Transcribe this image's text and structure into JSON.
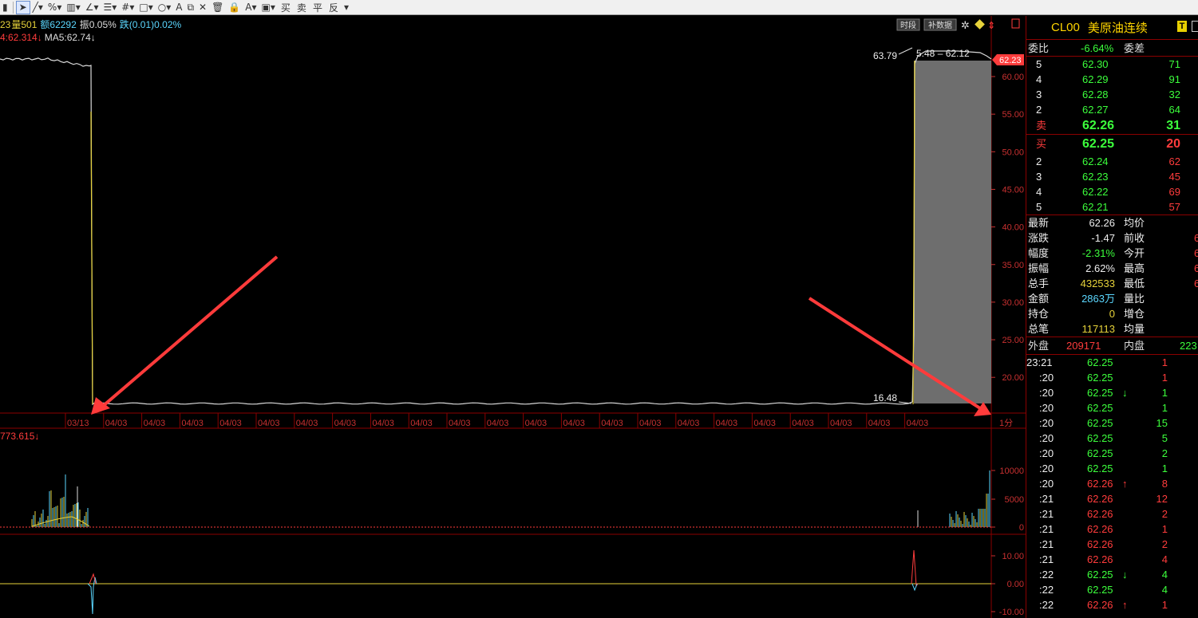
{
  "toolbar": {
    "trade_labels": [
      "买",
      "卖",
      "平",
      "反"
    ]
  },
  "chart": {
    "info_line": {
      "prefix": "23",
      "vol_label": "量501",
      "amount_label": "额62292",
      "amp_label": "振0.05%",
      "change_label": "跌(0.01)0.02%"
    },
    "ma_line": {
      "ma_value": "4:62.314↓",
      "ma5": "MA5:62.74↓"
    },
    "buttons": {
      "time_share": "时段",
      "fill_data": "补数据"
    },
    "price_labels": {
      "high": "63.79",
      "range": "5.48 – 62.12",
      "low": "16.48",
      "current": "62.23"
    },
    "price_axis": [
      "60.00",
      "55.00",
      "50.00",
      "45.00",
      "40.00",
      "35.00",
      "30.00",
      "25.00",
      "20.00"
    ],
    "date_axis": [
      "03/13",
      "04/03",
      "04/03",
      "04/03",
      "04/03",
      "04/03",
      "04/03",
      "04/03",
      "04/03",
      "04/03",
      "04/03",
      "04/03",
      "04/03",
      "04/03",
      "04/03",
      "04/03",
      "04/03",
      "04/03",
      "04/03",
      "04/03",
      "04/03",
      "04/03",
      "04/03"
    ],
    "period_label": "1分",
    "volume": {
      "label": "773.615↓",
      "axis": [
        "10000",
        "5000",
        "0"
      ]
    },
    "indicator": {
      "axis": [
        "10.00",
        "0.00",
        "-10.00"
      ]
    },
    "colors": {
      "grid": "#8b0000",
      "axis_text": "#c83030",
      "price_line": "#d8d8d8",
      "ma_line": "#e6d23a",
      "fill": "#6e6e6e",
      "arrow": "#ff3b3b"
    }
  },
  "quote": {
    "code": "CL00",
    "name": "美原油连续",
    "ratio_label": "委比",
    "ratio_value": "-6.64%",
    "diff_label": "委差",
    "sells": [
      {
        "level": "5",
        "price": "62.30",
        "vol": "71"
      },
      {
        "level": "4",
        "price": "62.29",
        "vol": "91"
      },
      {
        "level": "3",
        "price": "62.28",
        "vol": "32"
      },
      {
        "level": "2",
        "price": "62.27",
        "vol": "64"
      },
      {
        "level": "卖",
        "price": "62.26",
        "vol": "31"
      }
    ],
    "buys": [
      {
        "level": "买",
        "price": "62.25",
        "vol": "20"
      },
      {
        "level": "2",
        "price": "62.24",
        "vol": "62"
      },
      {
        "level": "3",
        "price": "62.23",
        "vol": "45"
      },
      {
        "level": "4",
        "price": "62.22",
        "vol": "69"
      },
      {
        "level": "5",
        "price": "62.21",
        "vol": "57"
      }
    ],
    "stats": [
      {
        "l1": "最新",
        "v1": "62.26",
        "c1": "white",
        "l2": "均价",
        "v2": ""
      },
      {
        "l1": "涨跌",
        "v1": "-1.47",
        "c1": "white",
        "l2": "前收",
        "v2": "6"
      },
      {
        "l1": "幅度",
        "v1": "-2.31%",
        "c1": "green",
        "l2": "今开",
        "v2": "6"
      },
      {
        "l1": "振幅",
        "v1": "2.62%",
        "c1": "white",
        "l2": "最高",
        "v2": "6"
      },
      {
        "l1": "总手",
        "v1": "432533",
        "c1": "yellow",
        "l2": "最低",
        "v2": "6"
      },
      {
        "l1": "金额",
        "v1": "2863万",
        "c1": "cyan",
        "l2": "量比",
        "v2": ""
      },
      {
        "l1": "持仓",
        "v1": "0",
        "c1": "yellow",
        "l2": "增仓",
        "v2": ""
      },
      {
        "l1": "总笔",
        "v1": "117113",
        "c1": "yellow",
        "l2": "均量",
        "v2": ""
      }
    ],
    "outer_label": "外盘",
    "outer_value": "209171",
    "inner_label": "内盘",
    "inner_value": "223",
    "ticks": [
      {
        "time": "23:21",
        "price": "62.25",
        "dir": "",
        "vol": "1",
        "vc": "red"
      },
      {
        "time": ":20",
        "price": "62.25",
        "dir": "",
        "vol": "1",
        "vc": "red"
      },
      {
        "time": ":20",
        "price": "62.25",
        "dir": "↓",
        "vol": "1",
        "vc": "green"
      },
      {
        "time": ":20",
        "price": "62.25",
        "dir": "",
        "vol": "1",
        "vc": "green"
      },
      {
        "time": ":20",
        "price": "62.25",
        "dir": "",
        "vol": "15",
        "vc": "green"
      },
      {
        "time": ":20",
        "price": "62.25",
        "dir": "",
        "vol": "5",
        "vc": "green"
      },
      {
        "time": ":20",
        "price": "62.25",
        "dir": "",
        "vol": "2",
        "vc": "green"
      },
      {
        "time": ":20",
        "price": "62.25",
        "dir": "",
        "vol": "1",
        "vc": "green"
      },
      {
        "time": ":20",
        "price": "62.26",
        "dir": "↑",
        "vol": "8",
        "vc": "red"
      },
      {
        "time": ":21",
        "price": "62.26",
        "dir": "",
        "vol": "12",
        "vc": "red"
      },
      {
        "time": ":21",
        "price": "62.26",
        "dir": "",
        "vol": "2",
        "vc": "red"
      },
      {
        "time": ":21",
        "price": "62.26",
        "dir": "",
        "vol": "1",
        "vc": "red"
      },
      {
        "time": ":21",
        "price": "62.26",
        "dir": "",
        "vol": "2",
        "vc": "red"
      },
      {
        "time": ":21",
        "price": "62.26",
        "dir": "",
        "vol": "4",
        "vc": "red"
      },
      {
        "time": ":22",
        "price": "62.25",
        "dir": "↓",
        "vol": "4",
        "vc": "green"
      },
      {
        "time": ":22",
        "price": "62.25",
        "dir": "",
        "vol": "4",
        "vc": "green"
      },
      {
        "time": ":22",
        "price": "62.26",
        "dir": "↑",
        "vol": "1",
        "vc": "red"
      }
    ]
  }
}
